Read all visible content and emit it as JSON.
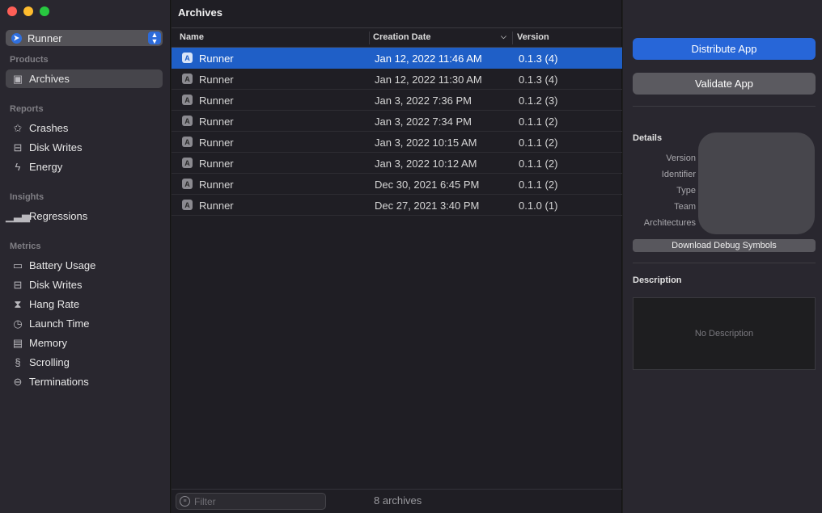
{
  "window": {
    "traffic_lights": [
      "close",
      "minimize",
      "zoom"
    ]
  },
  "sidebar": {
    "scheme_name": "Runner",
    "sections": [
      {
        "title": "Products",
        "items": [
          {
            "label": "Archives",
            "icon": "archive-icon",
            "selected": true
          }
        ]
      },
      {
        "title": "Reports",
        "items": [
          {
            "label": "Crashes",
            "icon": "crash-star-icon"
          },
          {
            "label": "Disk Writes",
            "icon": "disk-icon"
          },
          {
            "label": "Energy",
            "icon": "energy-bolt-icon"
          }
        ]
      },
      {
        "title": "Insights",
        "items": [
          {
            "label": "Regressions",
            "icon": "regressions-bars-icon"
          }
        ]
      },
      {
        "title": "Metrics",
        "items": [
          {
            "label": "Battery Usage",
            "icon": "battery-icon"
          },
          {
            "label": "Disk Writes",
            "icon": "disk-icon"
          },
          {
            "label": "Hang Rate",
            "icon": "hourglass-icon"
          },
          {
            "label": "Launch Time",
            "icon": "clock-icon"
          },
          {
            "label": "Memory",
            "icon": "memory-chip-icon"
          },
          {
            "label": "Scrolling",
            "icon": "scrolling-icon"
          },
          {
            "label": "Terminations",
            "icon": "terminations-icon"
          }
        ]
      }
    ]
  },
  "main": {
    "title": "Archives",
    "columns": {
      "name": "Name",
      "date": "Creation Date",
      "version": "Version"
    },
    "rows": [
      {
        "name": "Runner",
        "date": "Jan 12, 2022 11:46 AM",
        "version": "0.1.3 (4)",
        "selected": true
      },
      {
        "name": "Runner",
        "date": "Jan 12, 2022 11:30 AM",
        "version": "0.1.3 (4)"
      },
      {
        "name": "Runner",
        "date": "Jan 3, 2022 7:36 PM",
        "version": "0.1.2 (3)"
      },
      {
        "name": "Runner",
        "date": "Jan 3, 2022 7:34 PM",
        "version": "0.1.1 (2)"
      },
      {
        "name": "Runner",
        "date": "Jan 3, 2022 10:15 AM",
        "version": "0.1.1 (2)"
      },
      {
        "name": "Runner",
        "date": "Jan 3, 2022 10:12 AM",
        "version": "0.1.1 (2)"
      },
      {
        "name": "Runner",
        "date": "Dec 30, 2021 6:45 PM",
        "version": "0.1.1 (2)"
      },
      {
        "name": "Runner",
        "date": "Dec 27, 2021 3:40 PM",
        "version": "0.1.0 (1)"
      }
    ],
    "filter_placeholder": "Filter",
    "count_label": "8 archives"
  },
  "inspector": {
    "distribute_label": "Distribute App",
    "validate_label": "Validate App",
    "details_heading": "Details",
    "detail_labels": {
      "version": "Version",
      "identifier": "Identifier",
      "type": "Type",
      "team": "Team",
      "architectures": "Architectures"
    },
    "download_symbols_label": "Download Debug Symbols",
    "description_heading": "Description",
    "description_placeholder": "No Description"
  },
  "colors": {
    "accent": "#2766d8",
    "selection": "#1f5fc7"
  }
}
